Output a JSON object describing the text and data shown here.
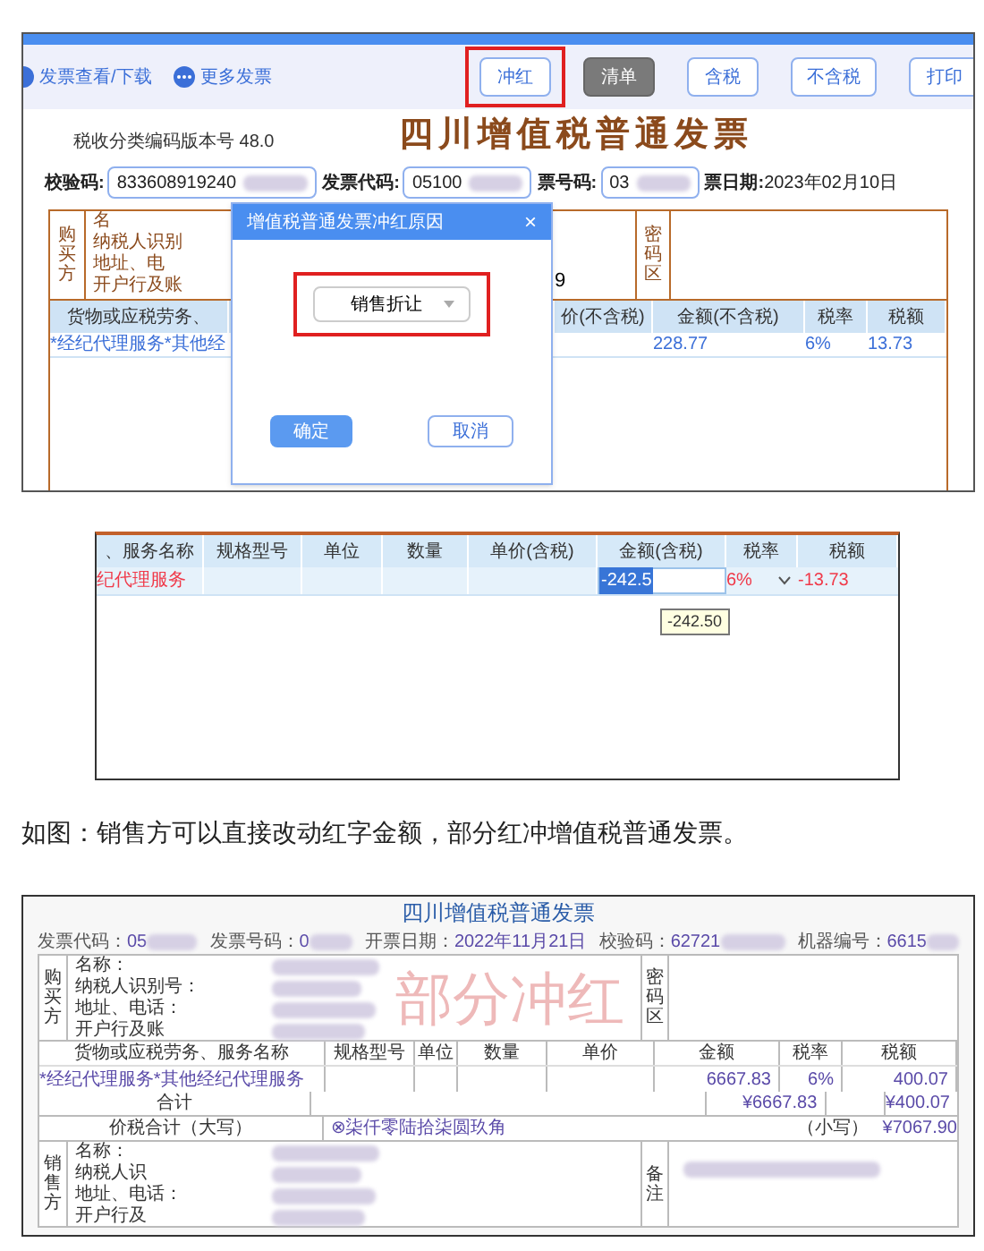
{
  "screenshot_1": {
    "toolbar": {
      "links": [
        "发票查看/下载",
        "更多发票"
      ],
      "buttons": [
        {
          "label": "冲红",
          "kind": "outline",
          "highlighted": true
        },
        {
          "label": "清单",
          "kind": "filled",
          "highlighted": false
        },
        {
          "label": "含税",
          "kind": "outline",
          "highlighted": false
        },
        {
          "label": "不含税",
          "kind": "outline",
          "highlighted": false
        },
        {
          "label": "打印",
          "kind": "outline",
          "highlighted": false
        }
      ]
    },
    "version_label": "税收分类编码版本号",
    "version": "48.0",
    "title": "四川增值税普通发票",
    "fields": [
      {
        "label": "校验码:",
        "value": "833608919240"
      },
      {
        "label": "发票代码:",
        "value": "05100"
      },
      {
        "label": "票号码:",
        "value": "03"
      }
    ],
    "date": {
      "label": "票日期:",
      "value": "2023年02月10日"
    },
    "buyer": {
      "side_label": "购买方",
      "rows": [
        "名",
        "纳税人识别",
        "地址、电",
        "开户行及账"
      ],
      "fragment": "9",
      "code_area_label": "密码区"
    },
    "items": {
      "columns": [
        "货物或应税劳务、",
        "价(不含税)",
        "金额(不含税)",
        "税率",
        "税额"
      ],
      "row": {
        "name": "*经纪代理服务*其他经",
        "amount": "228.77",
        "rate": "6%",
        "tax": "13.73"
      }
    },
    "dialog": {
      "title": "增值税普通发票冲红原因",
      "close": "×",
      "select": {
        "value": "销售折让",
        "highlighted": true
      },
      "buttons": [
        "确定",
        "取消"
      ]
    }
  },
  "screenshot_2": {
    "columns": [
      "、服务名称",
      "规格型号",
      "单位",
      "数量",
      "单价(含税)",
      "金额(含税)",
      "税率",
      "税额"
    ],
    "row": {
      "name": "纪代理服务",
      "amount": "-242.5",
      "rate": "6%",
      "tax": "-13.73"
    },
    "tooltip": "-242.50"
  },
  "caption": "如图：销售方可以直接改动红字金额，部分红冲增值税普通发票。",
  "screenshot_3": {
    "title": "四川增值税普通发票",
    "header_fields": [
      {
        "label": "发票代码：",
        "value": "05"
      },
      {
        "label": "发票号码：",
        "value": "0"
      },
      {
        "label": "开票日期：",
        "value": "2022年11月21日"
      },
      {
        "label": "校验码：",
        "value": "62721"
      },
      {
        "label": "机器编号：",
        "value": "6615"
      }
    ],
    "buyer": {
      "side_label": "购买方",
      "rows": [
        "名称：",
        "纳税人识别号：",
        "地址、电话：",
        "开户行及账"
      ],
      "code_area_label": "密码区"
    },
    "items": {
      "columns": [
        "货物或应税劳务、服务名称",
        "规格型号",
        "单位",
        "数量",
        "单价",
        "金额",
        "税率",
        "税额"
      ],
      "row": {
        "name": "*经纪代理服务*其他经纪代理服务",
        "amount": "6667.83",
        "rate": "6%",
        "tax": "400.07"
      },
      "total_label": "合计",
      "total_amount": "¥6667.83",
      "total_tax": "¥400.07"
    },
    "grand_total": {
      "label": "价税合计（大写）",
      "words": "⊗柒仟零陆拾柒圆玖角",
      "small_label": "（小写）",
      "small_value": "¥7067.90"
    },
    "seller": {
      "side_label": "销售方",
      "rows": [
        "名称：",
        "纳税人识",
        "地址、电话：",
        "开户行及"
      ],
      "remark_label": "备注"
    },
    "stamp": "部分冲红"
  }
}
